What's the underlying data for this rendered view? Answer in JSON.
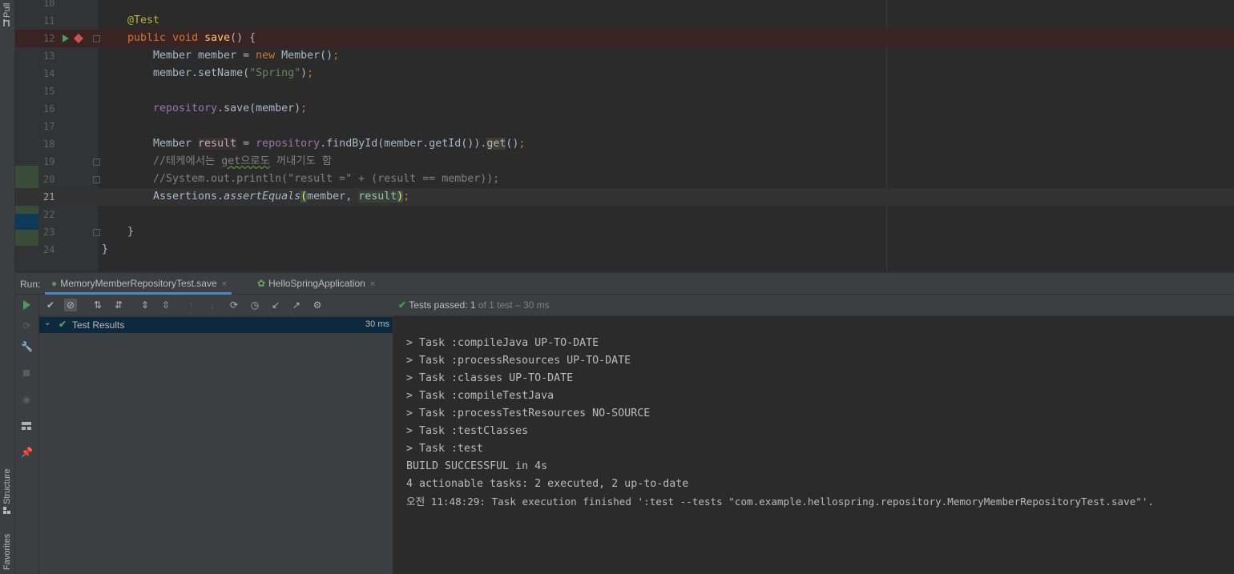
{
  "left_strip": {
    "top_tab": "Pull",
    "structure_tab": "Structure",
    "favorites_tab": "Favorites"
  },
  "editor": {
    "line_numbers": [
      "10",
      "11",
      "12",
      "13",
      "14",
      "15",
      "16",
      "17",
      "18",
      "19",
      "20",
      "21",
      "22",
      "23",
      "24"
    ],
    "current_line": "21",
    "lines": {
      "l11_ann": "@Test",
      "l12_kw1": "public",
      "l12_kw2": "void",
      "l12_fn": "save",
      "l12_rest": "() {",
      "l13_a": "Member member = ",
      "l13_kw": "new",
      "l13_b": " Member()",
      "l13_semi": ";",
      "l14_a": "member.setName(",
      "l14_str": "\"Spring\"",
      "l14_b": ")",
      "l14_semi": ";",
      "l16_fld": "repository",
      "l16_b": ".save(member)",
      "l16_semi": ";",
      "l18_a": "Member ",
      "l18_var": "result",
      "l18_b": " = ",
      "l18_fld": "repository",
      "l18_c": ".findById(member.getId()).",
      "l18_get": "get",
      "l18_d": "()",
      "l18_semi": ";",
      "l19_cmt_a": "//테케에서는 ",
      "l19_cmt_get": "get으로도",
      "l19_cmt_b": " 꺼내기도 함",
      "l20_cmt": "//System.out.println(\"result =\" + (result == member));",
      "l21_a": "Assertions.",
      "l21_fn": "assertEquals",
      "l21_paren_open": "(",
      "l21_b": "member, ",
      "l21_var": "result",
      "l21_paren_close": ")",
      "l21_semi": ";",
      "l23": "}",
      "l24": "}"
    }
  },
  "run": {
    "label": "Run:",
    "tabs": [
      {
        "label": "MemoryMemberRepositoryTest.save",
        "close": "×"
      },
      {
        "label": "HelloSpringApplication",
        "close": "×"
      }
    ],
    "status": {
      "prefix": "Tests passed: ",
      "passed": "1",
      "suffix": " of 1 test – 30 ms"
    },
    "tree": {
      "root_label": "Test Results",
      "root_time": "30 ms"
    },
    "console_lines": [
      "> Task :compileJava UP-TO-DATE",
      "> Task :processResources UP-TO-DATE",
      "> Task :classes UP-TO-DATE",
      "> Task :compileTestJava",
      "> Task :processTestResources NO-SOURCE",
      "> Task :testClasses",
      "> Task :test",
      "BUILD SUCCESSFUL in 4s",
      "4 actionable tasks: 2 executed, 2 up-to-date",
      "오전 11:48:29: Task execution finished ':test --tests \"com.example.hellospring.repository.MemoryMemberRepositoryTest.save\"'."
    ]
  },
  "colors": {
    "editor_bg": "#2b2b2b",
    "panel_bg": "#3c3f41",
    "breakpoint_line": "#3a2323",
    "success_green": "#499c54",
    "accent_blue": "#4a88c7"
  }
}
